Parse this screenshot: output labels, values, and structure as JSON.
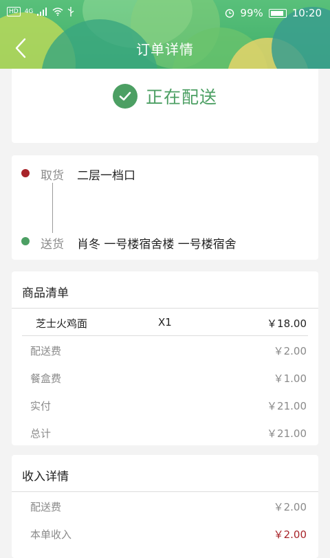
{
  "status_bar": {
    "network": "HD",
    "network_type": "4G",
    "battery": "99%",
    "time": "10:20"
  },
  "header": {
    "title": "订单详情",
    "back_icon": "chevron-left-icon"
  },
  "order_status": {
    "icon": "check-circle-icon",
    "text": "正在配送",
    "color": "#4c9f63"
  },
  "route": {
    "pickup_label": "取货",
    "pickup_value": "二层一档口",
    "delivery_label": "送货",
    "delivery_value": "肖冬 一号楼宿舍楼 一号楼宿舍"
  },
  "goods": {
    "title": "商品清单",
    "items": [
      {
        "name": "芝士火鸡面",
        "qty": "X1",
        "price": "￥18.00"
      }
    ],
    "rows": [
      {
        "label": "配送费",
        "value": "￥2.00"
      },
      {
        "label": "餐盒费",
        "value": "￥1.00"
      },
      {
        "label": "实付",
        "value": "￥21.00"
      },
      {
        "label": "总计",
        "value": "￥21.00"
      }
    ]
  },
  "income": {
    "title": "收入详情",
    "rows": [
      {
        "label": "配送费",
        "value": "￥2.00"
      },
      {
        "label": "本单收入",
        "value": "￥2.00"
      }
    ]
  },
  "colors": {
    "accent_green": "#4c9f63",
    "accent_red": "#a8242a"
  }
}
